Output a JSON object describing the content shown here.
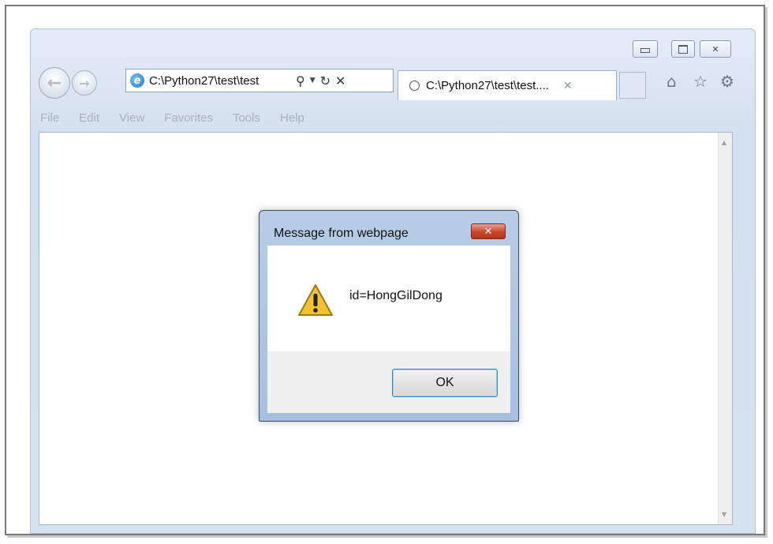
{
  "browser": {
    "address_text": "C:\\Python27\\test\\test",
    "tab_title": "C:\\Python27\\test\\test....",
    "menu": [
      "File",
      "Edit",
      "View",
      "Favorites",
      "Tools",
      "Help"
    ]
  },
  "dialog": {
    "title": "Message from webpage",
    "message": "id=HongGilDong",
    "ok_label": "OK"
  },
  "icons": {
    "back": "back-arrow-icon",
    "forward": "forward-arrow-icon",
    "search": "search-icon",
    "refresh": "refresh-icon",
    "stop": "stop-icon",
    "home": "home-icon",
    "favorites": "star-icon",
    "tools": "gear-icon",
    "warning": "warning-icon"
  },
  "colors": {
    "dialog_close": "#c9452c",
    "ok_focus": "#3c7fb1",
    "warning": "#f2c230"
  }
}
